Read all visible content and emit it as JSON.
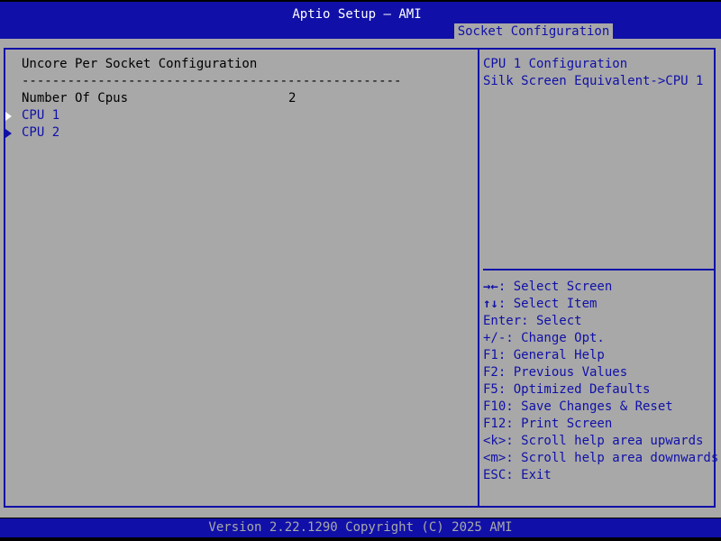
{
  "header": {
    "title": "Aptio Setup – AMI",
    "active_tab": "Socket Configuration"
  },
  "main": {
    "heading": "Uncore Per Socket Configuration",
    "separator": "--------------------------------------------------",
    "fields": [
      {
        "label": "Number Of Cpus",
        "value": "2"
      }
    ],
    "submenus": [
      {
        "label": "CPU 1"
      },
      {
        "label": "CPU 2"
      }
    ]
  },
  "help": {
    "lines": [
      "CPU 1 Configuration",
      "Silk Screen Equivalent->CPU 1"
    ]
  },
  "keys": [
    {
      "key": "→←",
      "desc": ": Select Screen"
    },
    {
      "key": "↑↓",
      "desc": ": Select Item"
    },
    {
      "key": "",
      "desc": "Enter: Select"
    },
    {
      "key": "",
      "desc": "+/-: Change Opt."
    },
    {
      "key": "",
      "desc": "F1: General Help"
    },
    {
      "key": "",
      "desc": "F2: Previous Values"
    },
    {
      "key": "",
      "desc": "F5: Optimized Defaults"
    },
    {
      "key": "",
      "desc": "F10: Save Changes & Reset"
    },
    {
      "key": "",
      "desc": "F12: Print Screen"
    },
    {
      "key": "",
      "desc": "<k>: Scroll help area upwards"
    },
    {
      "key": "",
      "desc": "<m>: Scroll help area downwards"
    },
    {
      "key": "",
      "desc": "ESC: Exit"
    }
  ],
  "footer": {
    "version": "Version 2.22.1290 Copyright (C) 2025 AMI"
  },
  "colors": {
    "bios_blue": "#1010a8",
    "bios_gray": "#a8a8a8",
    "text_black": "#000000",
    "text_white": "#ffffff"
  }
}
